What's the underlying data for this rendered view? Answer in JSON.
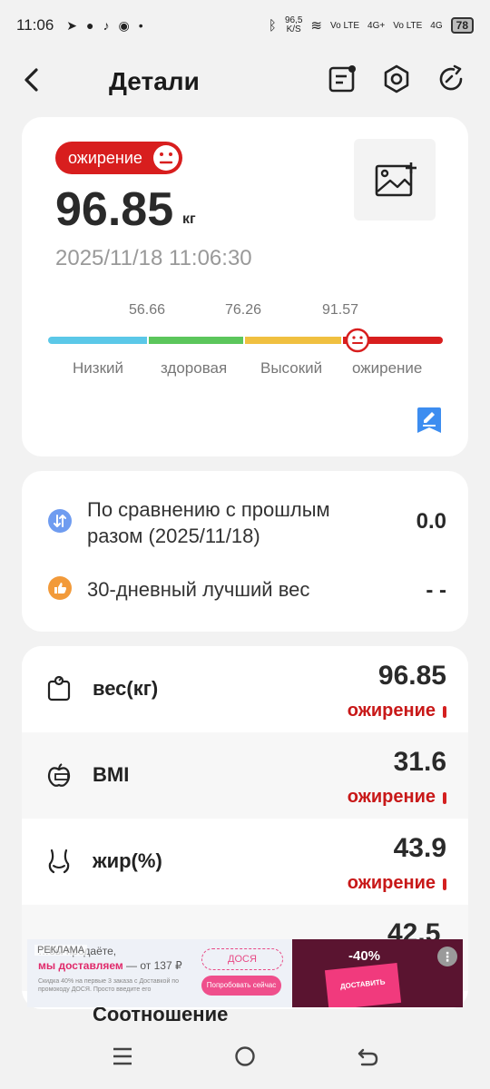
{
  "status_bar": {
    "time": "11:06",
    "speed": "96,5",
    "speed_unit": "K/S",
    "net1": "4G+",
    "net2": "4G",
    "volte": "Vo LTE",
    "battery": "78"
  },
  "toolbar": {
    "title": "Детали"
  },
  "summary": {
    "status_badge": "ожирение",
    "weight_value": "96.85",
    "weight_unit": "кг",
    "datetime": "2025/11/18 11:06:30",
    "thresholds": [
      "56.66",
      "76.26",
      "91.57"
    ],
    "ranges": [
      "Низкий",
      "здоровая",
      "Высокий",
      "ожирение"
    ],
    "colors": {
      "low": "#5bc8e8",
      "healthy": "#5cc65c",
      "high": "#f0c040",
      "obese": "#d81e1e"
    }
  },
  "comparison": {
    "prev_label": "По сравнению с прошлым разом (2025/11/18)",
    "prev_value": "0.0",
    "best_label": "30-дневный лучший вес",
    "best_value": "- -"
  },
  "metrics": [
    {
      "label": "вес(кг)",
      "value": "96.85",
      "status": "ожирение",
      "icon": "scale-icon"
    },
    {
      "label": "BMI",
      "value": "31.6",
      "status": "ожирение",
      "icon": "apple-tape-icon"
    },
    {
      "label": "жир(%)",
      "value": "43.9",
      "status": "ожирение",
      "icon": "body-fat-icon"
    }
  ],
  "cut_off": {
    "value": "42.5",
    "label": "Соотношение"
  },
  "ad": {
    "label": "РЕКЛАМА",
    "line1": "…бы продаёте,",
    "line2_prefix": "мы доставляем",
    "line2_suffix": " — от 137 ₽",
    "small": "Скидка 40% на первые 3 заказа с Доставкой по промокоду ДОСЯ. Просто введите его",
    "brand": "ДОСЯ",
    "cta": "Попробовать сейчас",
    "discount": "-40%",
    "bag_text": "ДОСТАВИТЬ",
    "info": "⋮"
  }
}
